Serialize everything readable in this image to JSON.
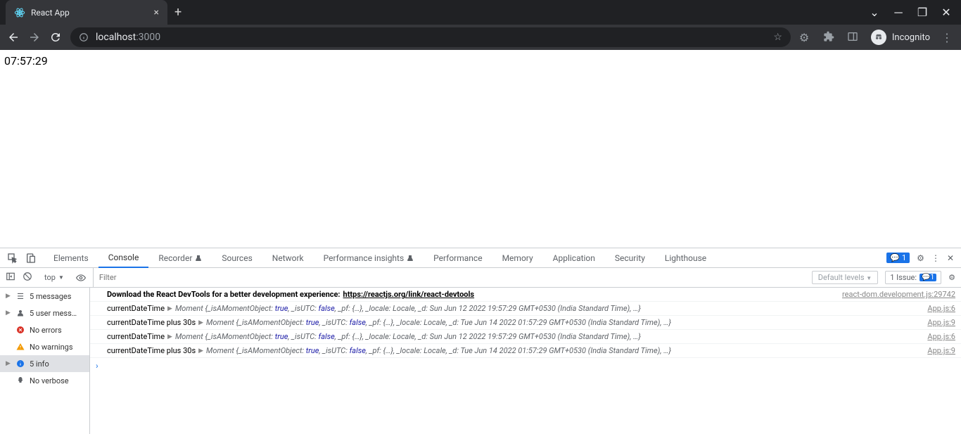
{
  "browser": {
    "tab_title": "React App",
    "url_host": "localhost",
    "url_port": ":3000",
    "incognito_label": "Incognito"
  },
  "page": {
    "time_text": "07:57:29"
  },
  "devtools": {
    "tabs": [
      "Elements",
      "Console",
      "Recorder",
      "Sources",
      "Network",
      "Performance insights",
      "Performance",
      "Memory",
      "Application",
      "Security",
      "Lighthouse"
    ],
    "active_tab": "Console",
    "feedback_count": "1",
    "context": "top",
    "filter_placeholder": "Filter",
    "levels_label": "Default levels",
    "issues_label": "1 Issue:",
    "issues_count": "1"
  },
  "sidebar": {
    "items": [
      {
        "label": "5 messages",
        "caret": true,
        "icon": "list"
      },
      {
        "label": "5 user mess…",
        "caret": true,
        "icon": "user"
      },
      {
        "label": "No errors",
        "caret": false,
        "icon": "err"
      },
      {
        "label": "No warnings",
        "caret": false,
        "icon": "warn"
      },
      {
        "label": "5 info",
        "caret": true,
        "icon": "info",
        "selected": true
      },
      {
        "label": "No verbose",
        "caret": false,
        "icon": "verb"
      }
    ]
  },
  "console": {
    "header_msg": "Download the React DevTools for a better development experience:",
    "header_link": "https://reactjs.org/link/react-devtools",
    "header_src": "react-dom.development.js:29742",
    "rows": [
      {
        "prefix": "currentDateTime",
        "obj": "Moment {_isAMomentObject: true, _isUTC: false, _pf: {…}, _locale: Locale, _d: Sun Jun 12 2022 19:57:29 GMT+0530 (India Standard Time), …}",
        "src": "App.js:6"
      },
      {
        "prefix": "currentDateTime plus 30s",
        "obj": "Moment {_isAMomentObject: true, _isUTC: false, _pf: {…}, _locale: Locale, _d: Tue Jun 14 2022 01:57:29 GMT+0530 (India Standard Time), …}",
        "src": "App.js:9"
      },
      {
        "prefix": "currentDateTime",
        "obj": "Moment {_isAMomentObject: true, _isUTC: false, _pf: {…}, _locale: Locale, _d: Sun Jun 12 2022 19:57:29 GMT+0530 (India Standard Time), …}",
        "src": "App.js:6"
      },
      {
        "prefix": "currentDateTime plus 30s",
        "obj": "Moment {_isAMomentObject: true, _isUTC: false, _pf: {…}, _locale: Locale, _d: Tue Jun 14 2022 01:57:29 GMT+0530 (India Standard Time), …}",
        "src": "App.js:9"
      }
    ]
  }
}
